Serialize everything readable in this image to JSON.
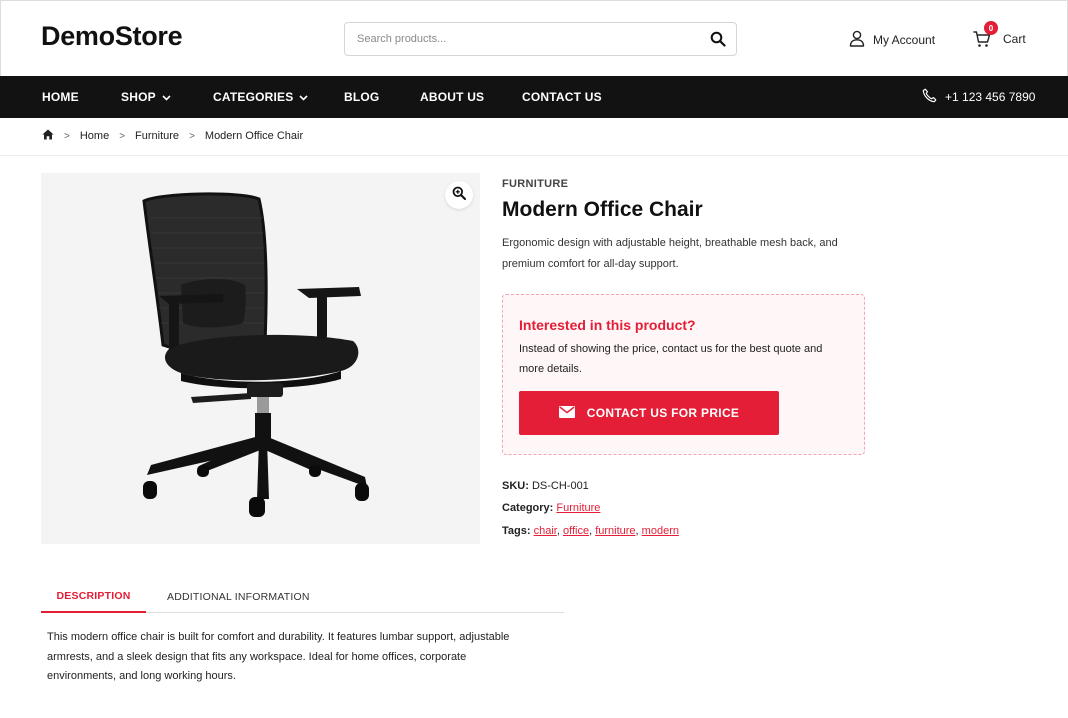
{
  "header": {
    "logo": "DemoStore",
    "search_placeholder": "Search products...",
    "account_label": "My Account",
    "cart_label": "Cart",
    "cart_count": "0"
  },
  "nav": {
    "items": [
      {
        "label": "HOME",
        "dropdown": false
      },
      {
        "label": "SHOP",
        "dropdown": true
      },
      {
        "label": "CATEGORIES",
        "dropdown": true
      },
      {
        "label": "BLOG",
        "dropdown": false
      },
      {
        "label": "ABOUT US",
        "dropdown": false
      },
      {
        "label": "CONTACT US",
        "dropdown": false
      }
    ],
    "phone": "+1 123 456 7890"
  },
  "breadcrumb": {
    "items": [
      "Home",
      "Furniture",
      "Modern Office Chair"
    ],
    "separator": ">"
  },
  "product": {
    "category": "FURNITURE",
    "title": "Modern Office Chair",
    "description": "Ergonomic design with adjustable height, breathable mesh back, and premium comfort for all-day support.",
    "image_alt": "office-chair-image"
  },
  "enquiry": {
    "title": "Interested in this product?",
    "text": "Instead of showing the price, contact us for the best quote and more details.",
    "button_label": "CONTACT US FOR PRICE"
  },
  "meta": {
    "sku_label": "SKU:",
    "sku_value": "DS-CH-001",
    "category_label": "Category:",
    "category_value": "Furniture",
    "tags_label": "Tags:",
    "tags": [
      "chair",
      "office",
      "furniture",
      "modern"
    ]
  },
  "tabs": {
    "items": [
      "DESCRIPTION",
      "ADDITIONAL INFORMATION"
    ],
    "active": "DESCRIPTION",
    "description_text": "This modern office chair is built for comfort and durability. It features lumbar support, adjustable armrests, and a sleek design that fits any workspace. Ideal for home offices, corporate environments, and long working hours."
  },
  "colors": {
    "accent": "#e31e36",
    "nav_bg": "#121212",
    "enquiry_bg": "#fff6f7"
  }
}
